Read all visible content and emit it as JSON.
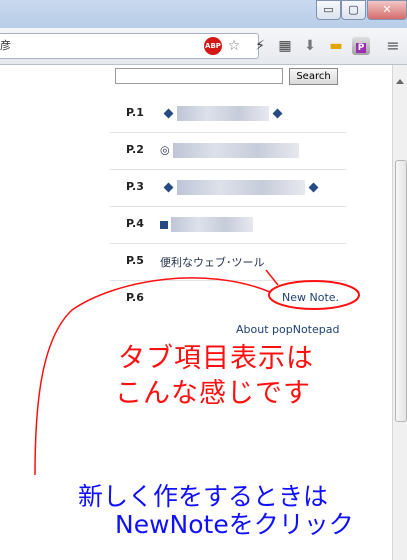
{
  "window": {
    "buttons": {
      "minimize": "▭",
      "maximize": "▢",
      "close": "✕"
    }
  },
  "toolbar": {
    "address_fragment": "彦",
    "extensions": [
      {
        "name": "adblock-icon",
        "glyph": "ABP"
      },
      {
        "name": "star-icon",
        "glyph": "☆"
      },
      {
        "name": "bolt-icon",
        "glyph": "⚡"
      },
      {
        "name": "clipboard-icon",
        "glyph": "▦"
      },
      {
        "name": "download-icon",
        "glyph": "⬇"
      },
      {
        "name": "note-icon",
        "glyph": "▬"
      },
      {
        "name": "popnotepad-icon",
        "glyph": "P"
      },
      {
        "name": "menu-icon",
        "glyph": "≡"
      }
    ]
  },
  "popup": {
    "search": {
      "value": "",
      "placeholder": "",
      "button_label": "Search"
    },
    "pages": [
      {
        "label": "P.1",
        "content": ""
      },
      {
        "label": "P.2",
        "content": "◎"
      },
      {
        "label": "P.3",
        "content": ""
      },
      {
        "label": "P.4",
        "content": ""
      },
      {
        "label": "P.5",
        "content": "便利なウェブ･ツール"
      },
      {
        "label": "P.6",
        "content": "New Note."
      }
    ],
    "about_label": "About popNotepad"
  },
  "annotations": {
    "tab_text_line1": "タブ項目表示は",
    "tab_text_line2": "こんな感じです",
    "new_text_line1": "新しく作をするときは",
    "new_text_line2": "NewNoteをクリック"
  },
  "colors": {
    "annotation_red": "#ff1010",
    "annotation_blue": "#1010ff",
    "link": "#1f3f73"
  }
}
